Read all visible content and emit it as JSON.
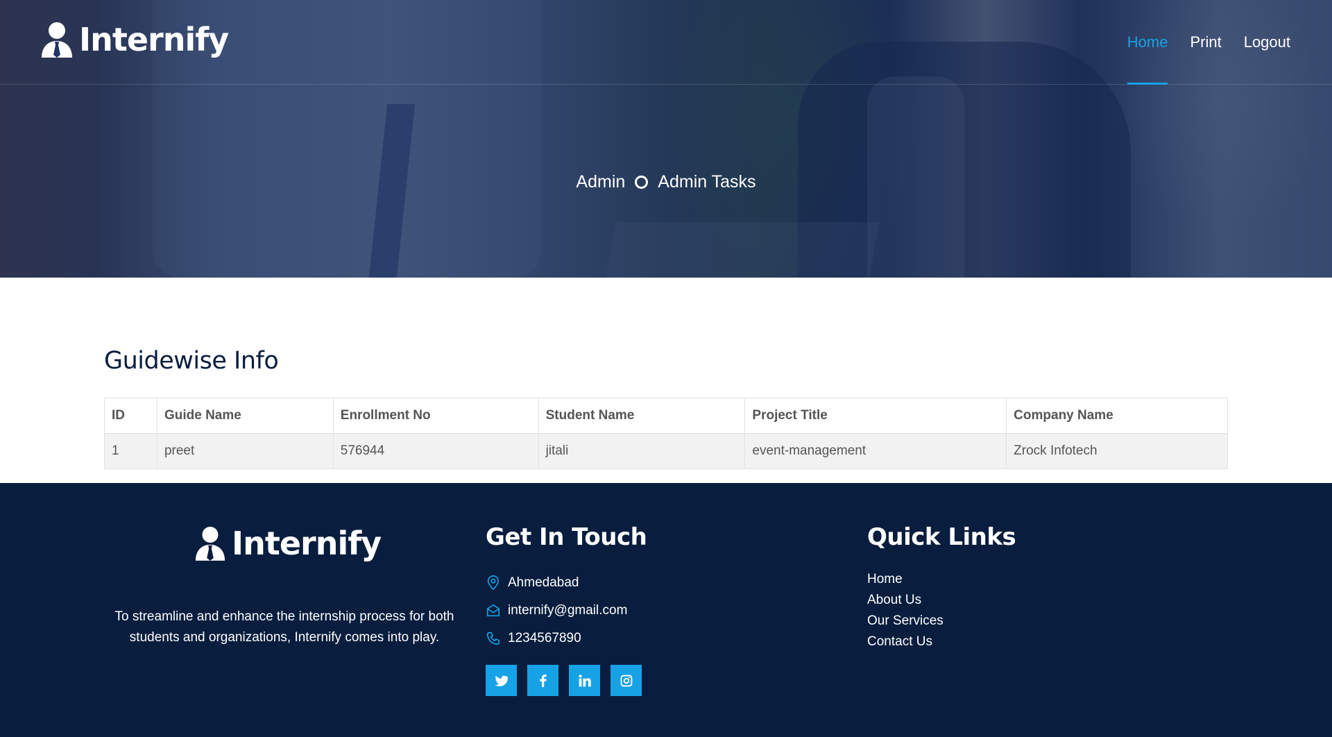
{
  "brand": {
    "name": "Internify"
  },
  "nav": {
    "items": [
      {
        "label": "Home",
        "active": true
      },
      {
        "label": "Print",
        "active": false
      },
      {
        "label": "Logout",
        "active": false
      }
    ]
  },
  "breadcrumb": {
    "items": [
      "Admin",
      "Admin Tasks"
    ]
  },
  "section": {
    "title": "Guidewise Info"
  },
  "table": {
    "headers": [
      "ID",
      "Guide Name",
      "Enrollment No",
      "Student Name",
      "Project Title",
      "Company Name"
    ],
    "rows": [
      [
        "1",
        "preet",
        "576944",
        "jitali",
        "event-management",
        "Zrock Infotech"
      ]
    ]
  },
  "footer": {
    "about": "To streamline and enhance the internship process for both students and organizations, Internify comes into play.",
    "contact_title": "Get In Touch",
    "contact": {
      "location": "Ahmedabad",
      "email": "internify@gmail.com",
      "phone": "1234567890"
    },
    "socials": [
      "twitter-icon",
      "facebook-icon",
      "linkedin-icon",
      "instagram-icon"
    ],
    "links_title": "Quick Links",
    "links": [
      "Home",
      "About Us",
      "Our Services",
      "Contact Us"
    ]
  },
  "colors": {
    "accent": "#17a2e6",
    "navy": "#091e3e"
  }
}
